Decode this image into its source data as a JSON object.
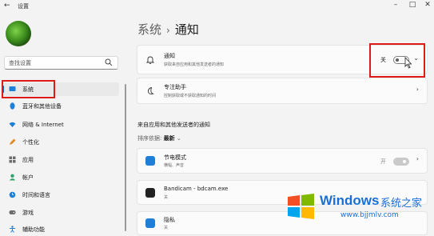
{
  "window": {
    "title": "设置"
  },
  "sidebar": {
    "search_placeholder": "查找设置",
    "items": [
      {
        "label": "系统",
        "icon": "system-icon",
        "active": true
      },
      {
        "label": "蓝牙和其他设备",
        "icon": "bluetooth-icon"
      },
      {
        "label": "网络 & Internet",
        "icon": "network-icon"
      },
      {
        "label": "个性化",
        "icon": "personalization-icon"
      },
      {
        "label": "应用",
        "icon": "apps-icon"
      },
      {
        "label": "帐户",
        "icon": "accounts-icon"
      },
      {
        "label": "时间和语言",
        "icon": "time-language-icon"
      },
      {
        "label": "游戏",
        "icon": "gaming-icon"
      },
      {
        "label": "辅助功能",
        "icon": "accessibility-icon"
      }
    ]
  },
  "breadcrumb": {
    "parent": "系统",
    "current": "通知"
  },
  "notifications_card": {
    "title": "通知",
    "subtitle": "获取来自应用和其他发送者的通知",
    "toggle_state_label": "关",
    "toggle_on": false
  },
  "focus_card": {
    "title": "专注助手",
    "subtitle": "控制获取或不获取通知的时间"
  },
  "apps_section": {
    "heading": "来自应用和其他发送者的通知",
    "sort_label": "排序依据:",
    "sort_value": "最新",
    "apps": [
      {
        "name": "节电模式",
        "detail": "横幅、声音",
        "state": "开"
      },
      {
        "name": "Bandicam - bdcam.exe",
        "detail": "关"
      },
      {
        "name": "隐私",
        "detail": "关"
      }
    ]
  },
  "watermark": {
    "brand": "Windows",
    "suffix": "系统之家",
    "url": "www.bjjmlv.com"
  },
  "colors": {
    "accent": "#005fb8",
    "highlight": "#e01919",
    "watermark": "#1a6fd6"
  }
}
